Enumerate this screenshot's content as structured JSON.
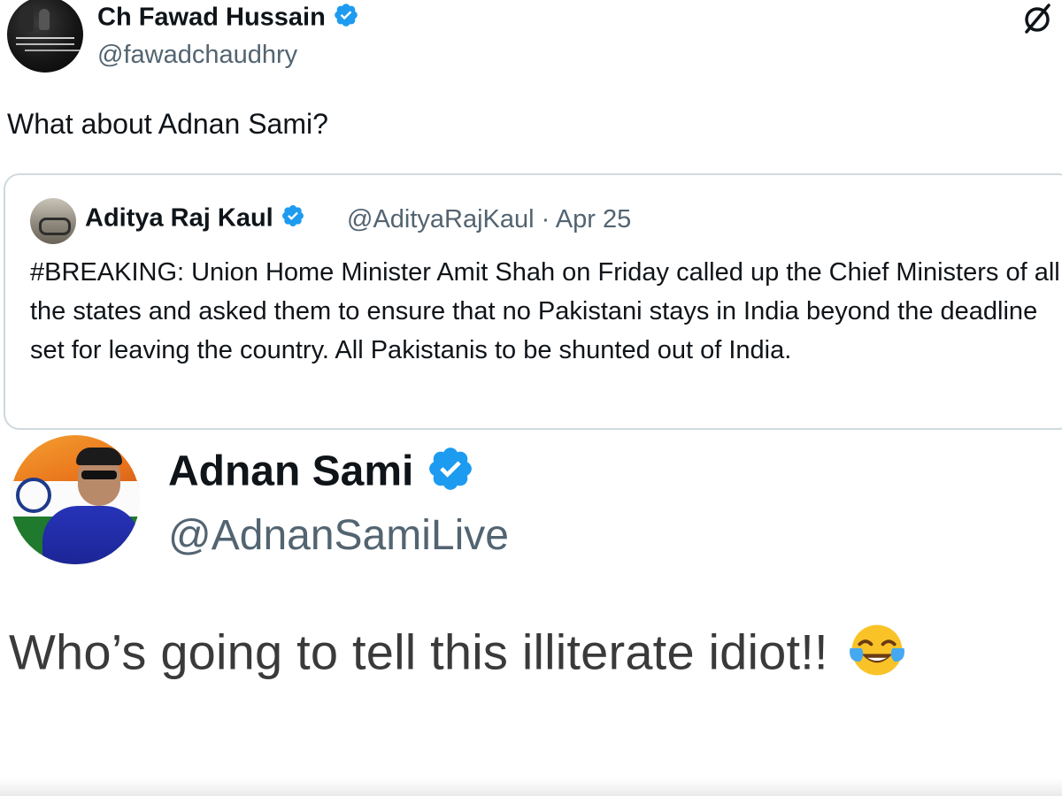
{
  "tweet1": {
    "author_name": "Ch Fawad Hussain",
    "author_handle": "@fawadchaudhry",
    "text": "What about Adnan Sami?",
    "quoted": {
      "author_name": "Aditya Raj Kaul",
      "author_handle": "@AdityaRajKaul · Apr 25",
      "text": "#BREAKING: Union Home Minister Amit Shah on Friday called up the Chief Ministers of all the states and asked them to ensure that no Pakistani stays in India beyond the deadline set for leaving the country. All Pakistanis to be shunted out of India."
    }
  },
  "tweet2": {
    "author_name": "Adnan Sami",
    "author_handle": "@AdnanSamiLive",
    "text": "Who’s going to tell this illiterate idiot!!"
  },
  "icons": {
    "verified": "verified-badge-icon",
    "grok": "grok-icon",
    "emoji": "tears-of-joy-emoji-icon"
  },
  "colors": {
    "verified_blue": "#1d9bf0",
    "secondary_text": "#536471",
    "border": "#cfd9de"
  }
}
